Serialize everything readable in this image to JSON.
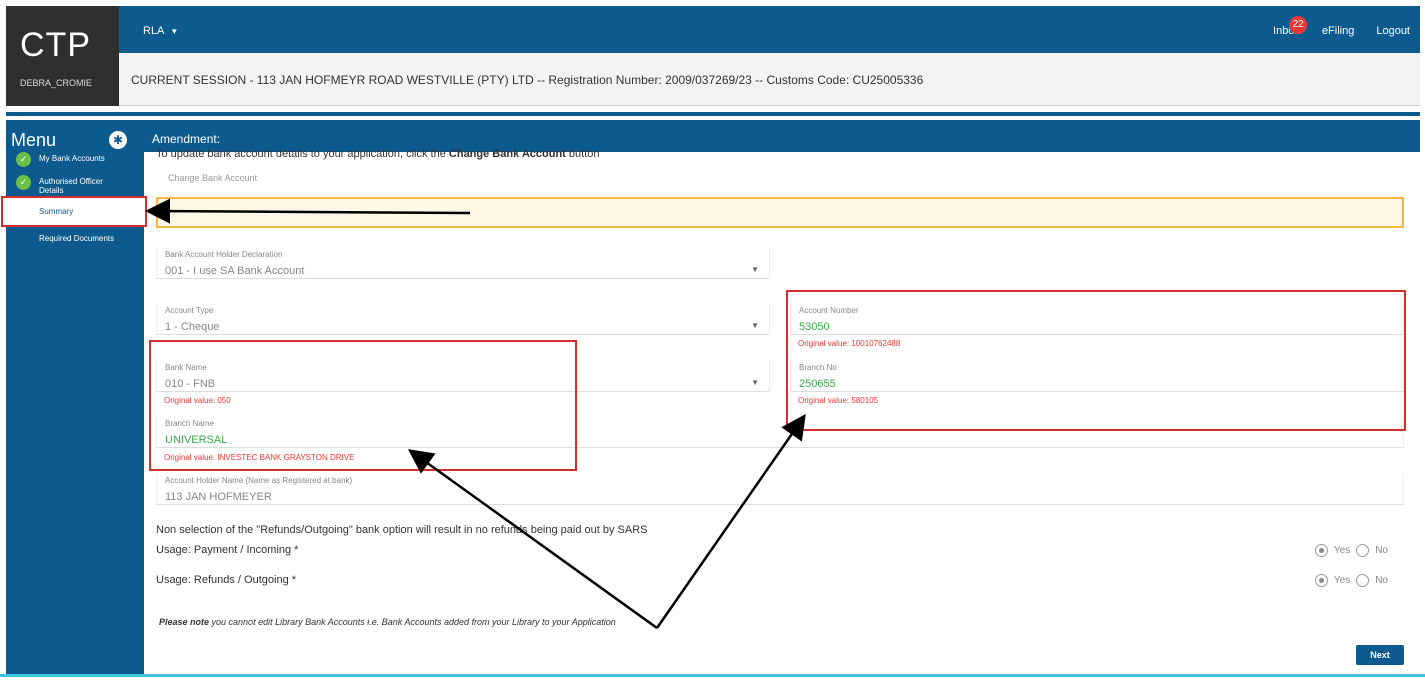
{
  "header": {
    "logo": "CTP",
    "user": "DEBRA_CROMIE",
    "role_menu": "RLA",
    "inbox": "Inbox",
    "inbox_count": "22",
    "efiling": "eFiling",
    "logout": "Logout",
    "session": "CURRENT SESSION - 113 JAN HOFMEYR ROAD WESTVILLE (PTY) LTD -- Registration Number: 2009/037269/23 -- Customs Code: CU25005336"
  },
  "sidebar": {
    "title": "Menu",
    "items": [
      {
        "label": "My Bank Accounts",
        "done": true
      },
      {
        "label": "Authorised Officer Details",
        "done": true
      },
      {
        "label": "Summary",
        "done": false
      },
      {
        "label": "Required Documents",
        "done": false
      }
    ]
  },
  "content": {
    "section_title": "Amendment:",
    "instruction_pre": "To update bank account details to your application, click the ",
    "instruction_bold": "Change Bank Account",
    "instruction_post": " button",
    "change_button": "Change Bank Account",
    "fields": {
      "declaration": {
        "label": "Bank Account Holder Declaration",
        "value": "001 - I use SA Bank Account"
      },
      "account_type": {
        "label": "Account Type",
        "value": "1 - Cheque"
      },
      "account_number": {
        "label": "Account Number",
        "value": "53050",
        "original": "Original value: 10010762488"
      },
      "bank_name": {
        "label": "Bank Name",
        "value": "010 - FNB",
        "original": "Original value: 050"
      },
      "branch_no": {
        "label": "Branch No",
        "value": "250655",
        "original": "Original value: 580105"
      },
      "branch_name": {
        "label": "Branch Name",
        "value": "UNIVERSAL",
        "original": "Original value: INVESTEC BANK GRAYSTON DRIVE"
      },
      "holder_name": {
        "label": "Account Holder Name (Name as Registered at bank)",
        "value": "113 JAN HOFMEYER"
      }
    },
    "refund_note": "Non selection of the \"Refunds/Outgoing\" bank option will result in no refunds being paid out by SARS",
    "usage_payment": "Usage: Payment / Incoming *",
    "usage_refunds": "Usage: Refunds / Outgoing *",
    "yes": "Yes",
    "no": "No",
    "please_note_bold": "Please note",
    "please_note_text": " you cannot edit Library Bank Accounts i.e. Bank Accounts added from your Library to your Application",
    "next_button": "Next"
  },
  "colors": {
    "primary": "#0c5a8e",
    "accent_red": "#d32f2f",
    "success": "#6cc04a",
    "changed_value": "#3aa84a"
  }
}
